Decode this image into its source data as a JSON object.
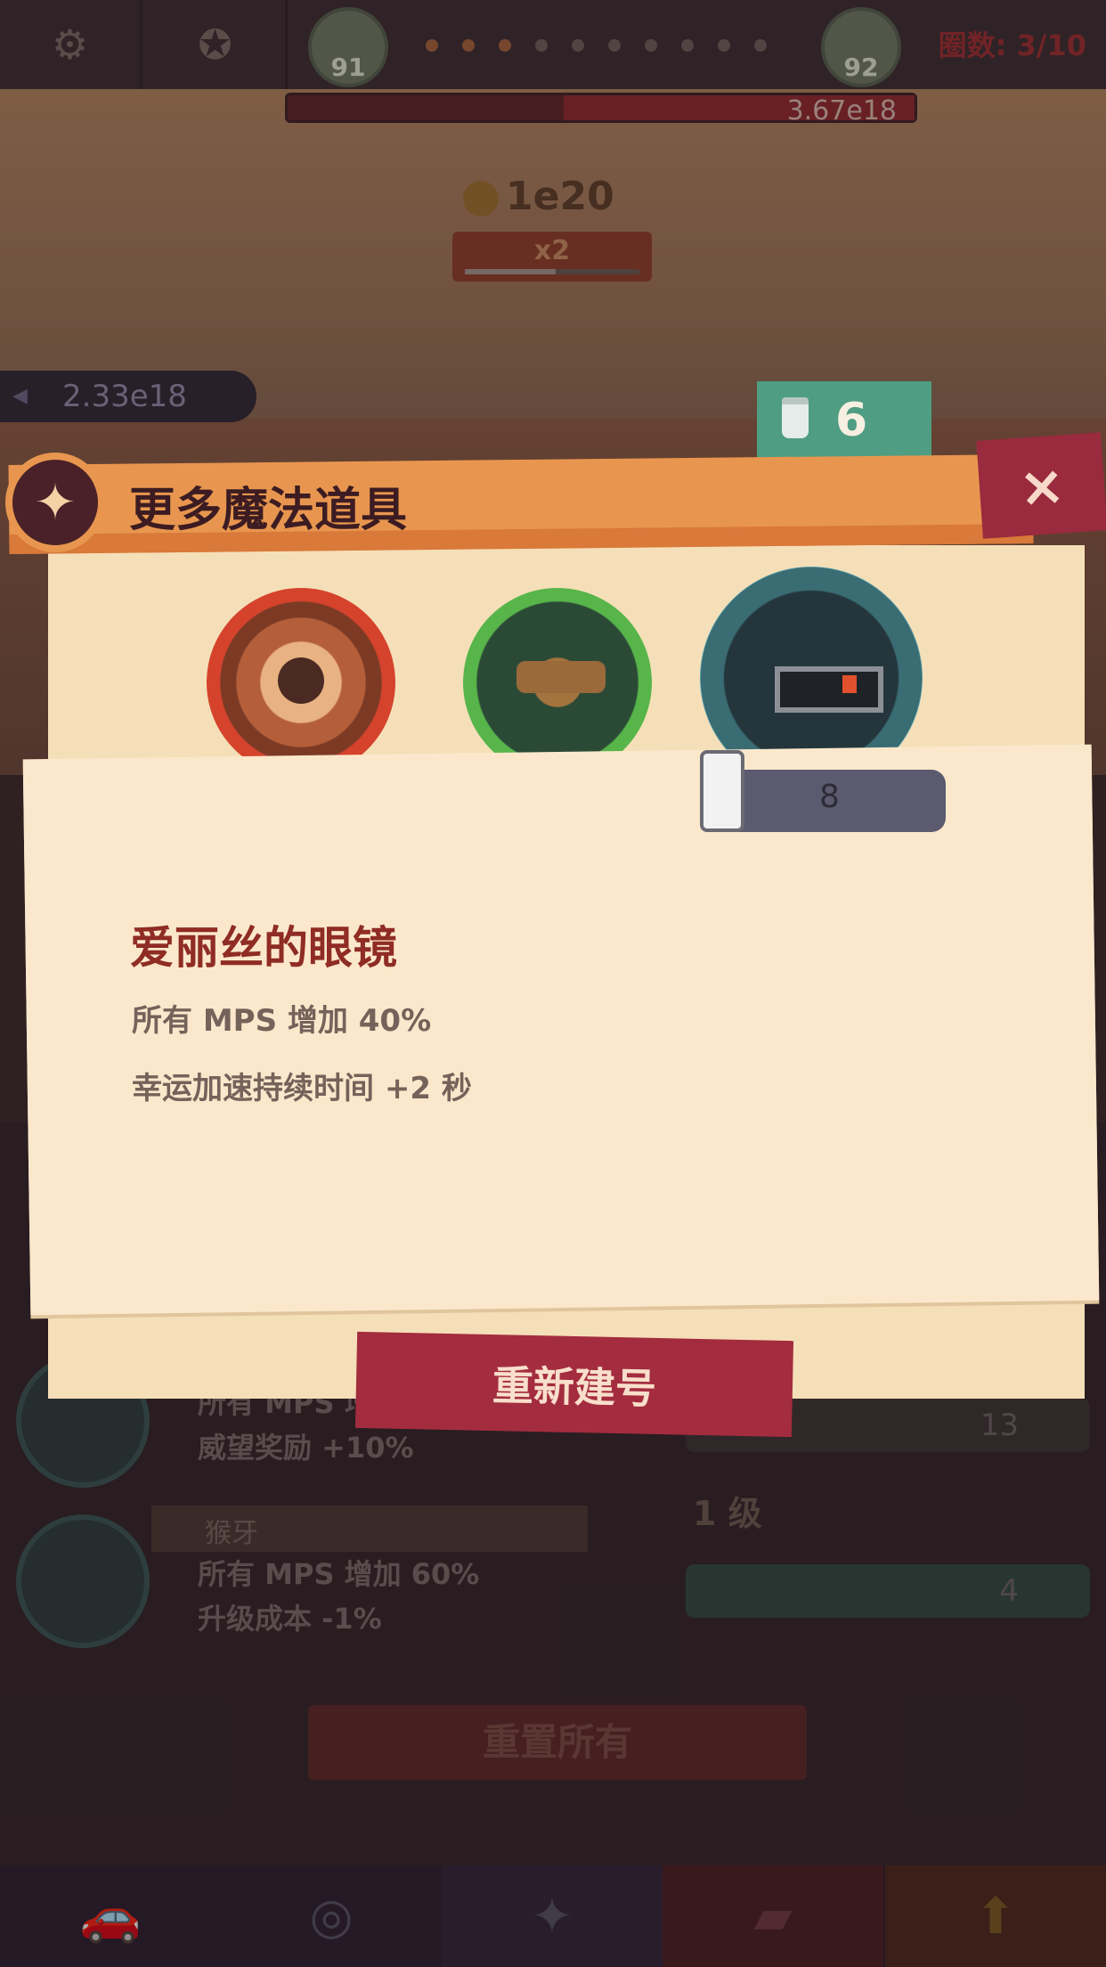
{
  "hud": {
    "level_left": "91",
    "level_right": "92",
    "wave_label": "圈数: 3/10",
    "enemy_hp": "3.67e18",
    "coins": "1e20",
    "boost_label": "x2",
    "boost_progress": 0.52,
    "distance": "2.33e18",
    "progress_dots_total": 10,
    "progress_dots_done": 3
  },
  "modal": {
    "title": "更多魔法道具",
    "close_symbol": "×",
    "jar_count": "6",
    "items": [
      {
        "icon": "gear-item-icon",
        "glow": "#d5432c"
      },
      {
        "icon": "gun-item-icon",
        "glow": "#57b54a"
      },
      {
        "icon": "glasses-item-icon",
        "glow": "#7cd6e2"
      }
    ],
    "selected": {
      "name": "爱丽丝的眼镜",
      "cost": "8",
      "effects": [
        "所有 MPS 增加 40%",
        "幸运加速持续时间 +2 秒"
      ]
    },
    "action_button": "重新建号"
  },
  "background_panel": {
    "upgrade_1": {
      "lines": [
        "所有 MPS 增",
        "威望奖励 +10%"
      ],
      "cost": "13"
    },
    "upgrade_2": {
      "name": "猴牙",
      "level": "1 级",
      "lines": [
        "所有 MPS 增加 60%",
        "升级成本 -1%"
      ],
      "cost": "4"
    },
    "reset_all": "重置所有"
  },
  "bottom_nav": [
    {
      "icon": "car-icon",
      "glyph": "🚗"
    },
    {
      "icon": "steering-wheel-icon",
      "glyph": "◎"
    },
    {
      "icon": "magic-star-icon",
      "glyph": "✦"
    },
    {
      "icon": "cards-icon",
      "glyph": "▰"
    },
    {
      "icon": "upgrade-arrow-icon",
      "glyph": "⬆"
    }
  ],
  "colors": {
    "title_bar": "#e8964f",
    "close_button": "#9a2a3e",
    "action_button": "#a42c3f",
    "jar_counter": "#4f9d82",
    "item_name": "#8f2c24"
  }
}
